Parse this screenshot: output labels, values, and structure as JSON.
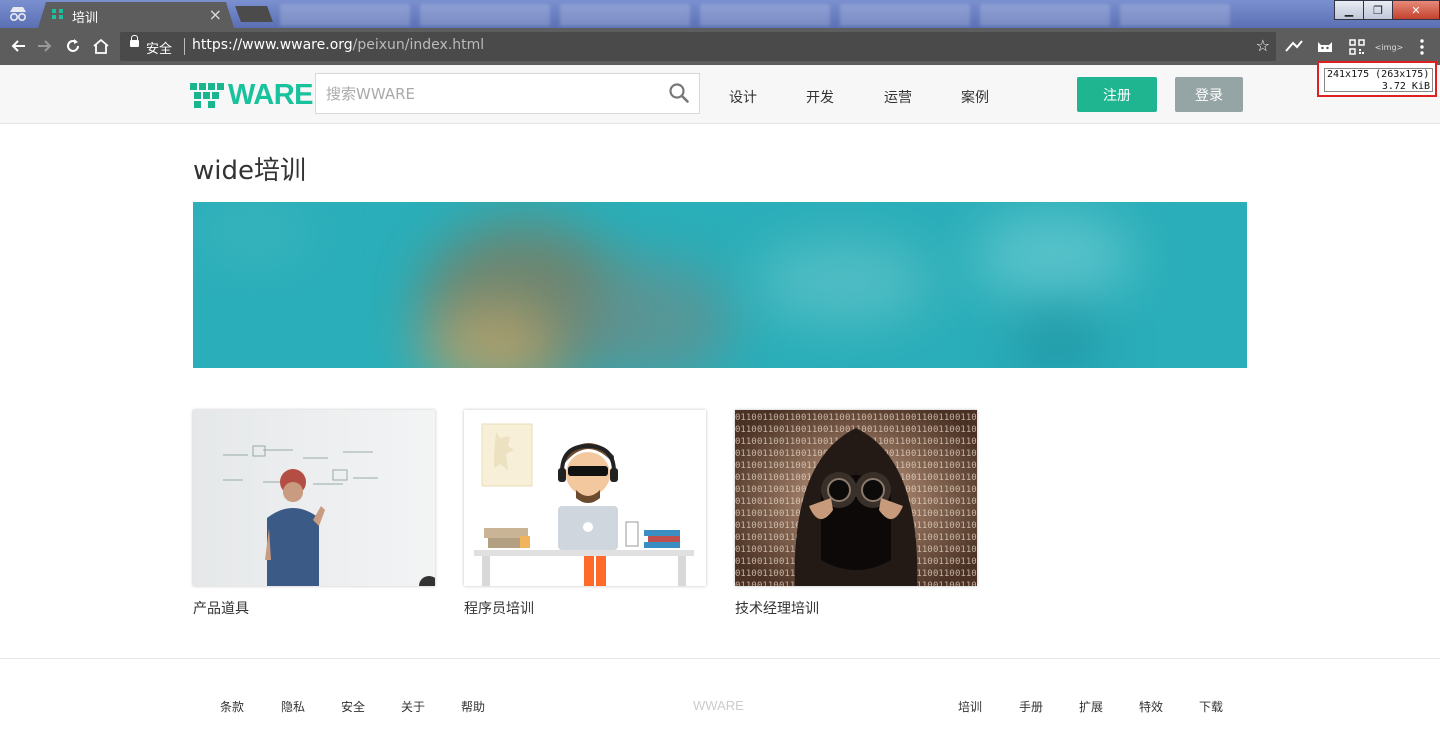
{
  "browser": {
    "active_tab_title": "培训",
    "secure_label": "安全",
    "url_host": "https://www.wware.org",
    "url_path": "/peixun/index.html"
  },
  "image_tooltip": {
    "dimensions": "241x175 (263x175)",
    "size": "3.72 KiB"
  },
  "header": {
    "logo_text": "WARE",
    "search_placeholder": "搜索WWARE",
    "nav": [
      "设计",
      "开发",
      "运营",
      "案例"
    ],
    "register_label": "注册",
    "login_label": "登录"
  },
  "main": {
    "title": "wide培训",
    "cards": [
      {
        "label": "产品道具"
      },
      {
        "label": "程序员培训"
      },
      {
        "label": "技术经理培训"
      }
    ]
  },
  "footer": {
    "left_links": [
      "条款",
      "隐私",
      "安全",
      "关于",
      "帮助"
    ],
    "brand": "WWARE",
    "right_links": [
      "培训",
      "手册",
      "扩展",
      "特效",
      "下载"
    ]
  },
  "colors": {
    "brand_green": "#1fb590",
    "login_gray": "#95a5a6",
    "banner_teal": "#2aaeb9"
  }
}
